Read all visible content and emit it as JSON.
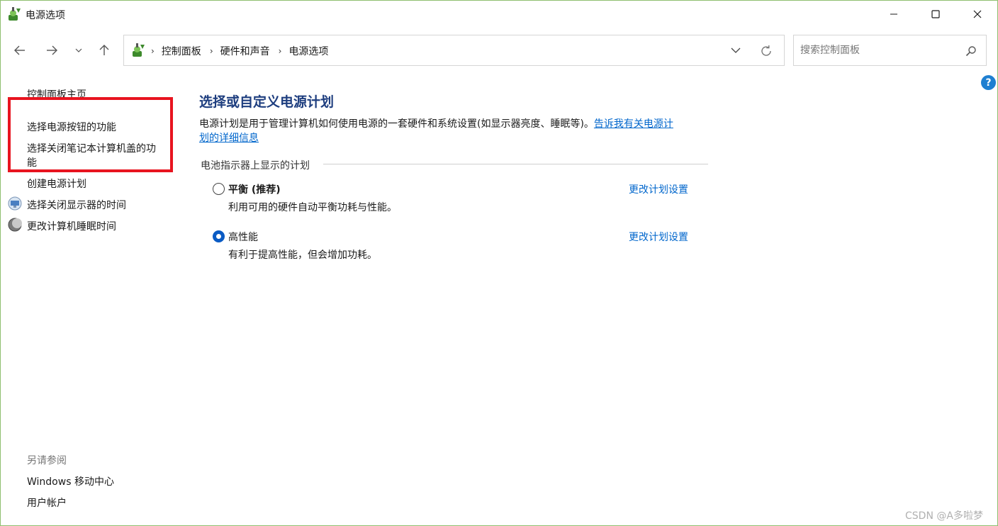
{
  "window": {
    "title": "电源选项",
    "app_icon": "power-options-icon",
    "controls": [
      "minimize-icon",
      "maximize-icon",
      "close-icon"
    ]
  },
  "nav": {
    "back_icon": "arrow-left-icon",
    "forward_icon": "arrow-right-icon",
    "recent_icon": "chevron-down-icon",
    "up_icon": "arrow-up-icon"
  },
  "address": {
    "breadcrumbs": [
      "控制面板",
      "硬件和声音",
      "电源选项"
    ],
    "dropdown_icon": "chevron-down-icon",
    "refresh_icon": "refresh-icon"
  },
  "search": {
    "placeholder": "搜索控制面板",
    "value": "",
    "icon": "search-icon"
  },
  "help_label": "?",
  "sidebar": {
    "home": "控制面板主页",
    "items": [
      {
        "label": "选择电源按钮的功能",
        "highlighted": true
      },
      {
        "label": "选择关闭笔记本计算机盖的功",
        "label_line2": "能",
        "highlighted": true
      },
      {
        "label": "创建电源计划"
      },
      {
        "label": "选择关闭显示器的时间",
        "icon": "display-icon"
      },
      {
        "label": "更改计算机睡眠时间",
        "icon": "sleep-moon-icon"
      }
    ],
    "see_also_title": "另请参阅",
    "see_also": [
      "Windows 移动中心",
      "用户帐户"
    ],
    "highlight_color": "#e8141f"
  },
  "main": {
    "title": "选择或自定义电源计划",
    "description": "电源计划是用于管理计算机如何使用电源的一套硬件和系统设置(如显示器亮度、睡眠等)。",
    "description_link_line1": "告诉我有关电源计",
    "description_link_line2": "划的详细信息",
    "group_label": "电池指示器上显示的计划",
    "plans": [
      {
        "name": "平衡 (推荐)",
        "description": "利用可用的硬件自动平衡功耗与性能。",
        "selected": false,
        "settings_link": "更改计划设置"
      },
      {
        "name": "高性能",
        "description": "有利于提高性能，但会增加功耗。",
        "selected": true,
        "settings_link": "更改计划设置"
      }
    ]
  },
  "colors": {
    "title_blue": "#1e3e7f",
    "link_blue": "#0066cc",
    "radio_selected": "#0a5bc4"
  },
  "watermark": "CSDN @A多啦梦"
}
